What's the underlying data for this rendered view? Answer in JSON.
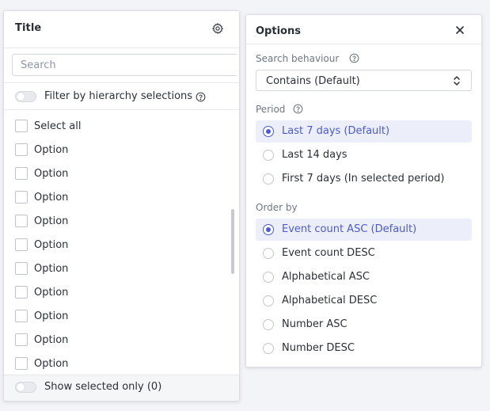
{
  "filter_panel": {
    "title": "Title",
    "search_placeholder": "Search",
    "hierarchy_toggle_label": "Filter by hierarchy selections",
    "select_all_label": "Select all",
    "options": [
      "Option",
      "Option",
      "Option",
      "Option",
      "Option",
      "Option",
      "Option",
      "Option",
      "Option",
      "Option"
    ],
    "show_selected_label": "Show selected only (0)"
  },
  "options_panel": {
    "title": "Options",
    "search_behaviour": {
      "label": "Search behaviour",
      "selected_value": "Contains (Default)"
    },
    "period": {
      "label": "Period",
      "choices": [
        "Last 7 days (Default)",
        "Last 14 days",
        "First 7 days (In selected period)"
      ],
      "selected_index": 0
    },
    "order_by": {
      "label": "Order by",
      "choices": [
        "Event count ASC (Default)",
        "Event count DESC",
        "Alphabetical ASC",
        "Alphabetical DESC",
        "Number ASC",
        "Number DESC"
      ],
      "selected_index": 0
    }
  },
  "colors": {
    "accent": "#4a5bd5",
    "selected_row_bg": "#eceef9",
    "page_bg": "#f3f4f8"
  },
  "icons": {
    "settings": "gear-icon",
    "help": "help-circle-icon",
    "close": "close-icon",
    "select_chevron": "chevron-up-down-icon"
  }
}
